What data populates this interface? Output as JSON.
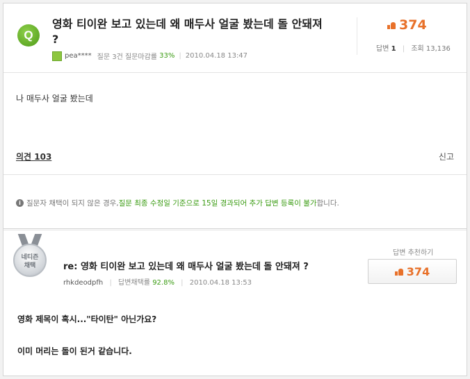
{
  "question": {
    "icon_letter": "Q",
    "title": "영화 티이완 보고 있는데 왜 매두사 얼굴 봤는데 돌 안돼져 ?",
    "user": "pea****",
    "question_count": "질문 3건",
    "close_rate_label": "질문마감률",
    "close_rate": "33%",
    "date": "2010.04.18 13:47",
    "likes": "374",
    "answers_label": "답변",
    "answers_count": "1",
    "views_label": "조회",
    "views_count": "13,136",
    "body": "나 매두사 얼굴 봤는데"
  },
  "opinion": {
    "label": "의견 103",
    "report": "신고"
  },
  "notice": {
    "text_before": "질문자 채택이 되지 않은 경우, ",
    "text_green": "질문 최종 수정일 기준으로 15일 경과되어 추가 답변 등록이 불가",
    "text_after": "합니다."
  },
  "answer": {
    "badge_line1": "네티즌",
    "badge_line2": "채택",
    "title": "re: 영화 티이완 보고 있는데 왜 매두사 얼굴 봤는데 돌 안돼져 ?",
    "user": "rhkdeodpfh",
    "adopt_rate_label": "답변채택률",
    "adopt_rate": "92.8%",
    "date": "2010.04.18 13:53",
    "recommend_label": "답변 추천하기",
    "likes": "374",
    "body_line1": "영화 제목이 혹시...\"타이탄\" 아닌가요?",
    "body_line2": "이미 머리는 돌이 된거 같습니다."
  },
  "colors": {
    "accent_orange": "#e8712a",
    "accent_green": "#3a9b12",
    "q_icon_green": "#6cb52a"
  }
}
